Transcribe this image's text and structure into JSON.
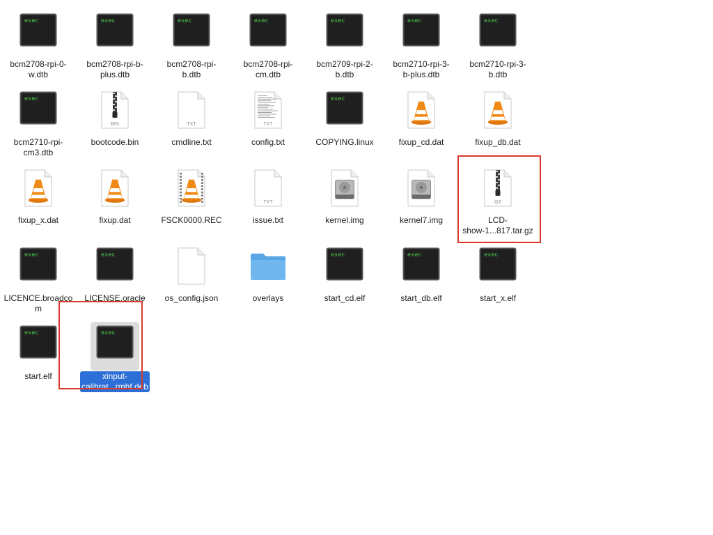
{
  "icon_text": {
    "exec": "exec",
    "bin": "BIN",
    "txt": "TXT",
    "gz": "GZ"
  },
  "colors": {
    "selection_label": "#2c6fd6",
    "selection_icon_bg": "#dcdcdc",
    "highlight_box": "#d93a2b",
    "exec_text": "#4fd24f",
    "vlc_orange": "#f08a16",
    "folder_blue": "#6fb7ee"
  },
  "files": [
    {
      "name": "bcm2708-rpi-0-w.dtb",
      "lines": [
        "bcm2708-rpi-0-",
        "w.dtb"
      ],
      "icon": "exec"
    },
    {
      "name": "bcm2708-rpi-b-plus.dtb",
      "lines": [
        "bcm2708-rpi-b-",
        "plus.dtb"
      ],
      "icon": "exec"
    },
    {
      "name": "bcm2708-rpi-b.dtb",
      "lines": [
        "bcm2708-rpi-",
        "b.dtb"
      ],
      "icon": "exec"
    },
    {
      "name": "bcm2708-rpi-cm.dtb",
      "lines": [
        "bcm2708-rpi-",
        "cm.dtb"
      ],
      "icon": "exec"
    },
    {
      "name": "bcm2709-rpi-2-b.dtb",
      "lines": [
        "bcm2709-rpi-2-",
        "b.dtb"
      ],
      "icon": "exec"
    },
    {
      "name": "bcm2710-rpi-3-b-plus.dtb",
      "lines": [
        "bcm2710-rpi-3-",
        "b-plus.dtb"
      ],
      "icon": "exec"
    },
    {
      "name": "bcm2710-rpi-3-b.dtb",
      "lines": [
        "bcm2710-rpi-3-",
        "b.dtb"
      ],
      "icon": "exec"
    },
    {
      "name": "bcm2710-rpi-cm3.dtb",
      "lines": [
        "bcm2710-rpi-",
        "cm3.dtb"
      ],
      "icon": "exec"
    },
    {
      "name": "bootcode.bin",
      "lines": [
        "bootcode.bin"
      ],
      "icon": "zip-bin"
    },
    {
      "name": "cmdline.txt",
      "lines": [
        "cmdline.txt"
      ],
      "icon": "txt"
    },
    {
      "name": "config.txt",
      "lines": [
        "config.txt"
      ],
      "icon": "txt-lines"
    },
    {
      "name": "COPYING.linux",
      "lines": [
        "COPYING.linux"
      ],
      "icon": "exec"
    },
    {
      "name": "fixup_cd.dat",
      "lines": [
        "fixup_cd.dat"
      ],
      "icon": "vlc"
    },
    {
      "name": "fixup_db.dat",
      "lines": [
        "fixup_db.dat"
      ],
      "icon": "vlc"
    },
    {
      "name": "fixup_x.dat",
      "lines": [
        "fixup_x.dat"
      ],
      "icon": "vlc"
    },
    {
      "name": "fixup.dat",
      "lines": [
        "fixup.dat"
      ],
      "icon": "vlc"
    },
    {
      "name": "FSCK0000.REC",
      "lines": [
        "FSCK0000.REC"
      ],
      "icon": "vlc-film"
    },
    {
      "name": "issue.txt",
      "lines": [
        "issue.txt"
      ],
      "icon": "txt"
    },
    {
      "name": "kernel.img",
      "lines": [
        "kernel.img"
      ],
      "icon": "disk"
    },
    {
      "name": "kernel7.img",
      "lines": [
        "kernel7.img"
      ],
      "icon": "disk"
    },
    {
      "name": "LCD-show-1...817.tar.gz",
      "lines": [
        "LCD-",
        "show-1...817.tar.gz"
      ],
      "icon": "zip-gz"
    },
    {
      "name": "LICENCE.broadcom",
      "lines": [
        "LICENCE.broadco",
        "m"
      ],
      "icon": "exec"
    },
    {
      "name": "LICENSE.oracle",
      "lines": [
        "LICENSE.oracle"
      ],
      "icon": "exec"
    },
    {
      "name": "os_config.json",
      "lines": [
        "os_config.json"
      ],
      "icon": "blank"
    },
    {
      "name": "overlays",
      "lines": [
        "overlays"
      ],
      "icon": "folder"
    },
    {
      "name": "start_cd.elf",
      "lines": [
        "start_cd.elf"
      ],
      "icon": "exec"
    },
    {
      "name": "start_db.elf",
      "lines": [
        "start_db.elf"
      ],
      "icon": "exec"
    },
    {
      "name": "start_x.elf",
      "lines": [
        "start_x.elf"
      ],
      "icon": "exec"
    },
    {
      "name": "start.elf",
      "lines": [
        "start.elf"
      ],
      "icon": "exec"
    },
    {
      "name": "xinput-calibrat...rmhf.deb",
      "lines": [
        "xinput-",
        "calibrat...rmhf.deb"
      ],
      "icon": "exec",
      "selected": true
    }
  ]
}
